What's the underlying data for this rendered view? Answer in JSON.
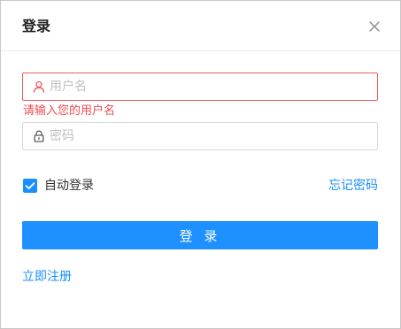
{
  "dialog": {
    "title": "登录",
    "close_icon": "close-icon"
  },
  "form": {
    "username": {
      "placeholder": "用户名",
      "value": "",
      "icon": "user-icon",
      "error": "请输入您的用户名"
    },
    "password": {
      "placeholder": "密码",
      "value": "",
      "icon": "lock-icon"
    },
    "remember": {
      "label": "自动登录",
      "checked": true
    },
    "forgot_label": "忘记密码",
    "submit_label": "登 录",
    "register_label": "立即注册"
  },
  "colors": {
    "accent": "#1890ff",
    "error": "#f04b4f"
  }
}
